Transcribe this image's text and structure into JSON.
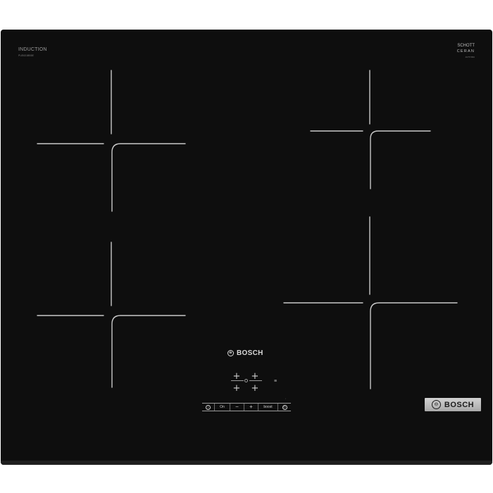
{
  "cooktop": {
    "type_label": "INDUCTION",
    "model_code": "PUE631BB5E",
    "glass_brand_top": "SCHOTT",
    "glass_brand_bottom": "CERAN",
    "serial_code": "40757682",
    "surface_color": "#0e0e0e",
    "marking_color": "#c8c8c8"
  },
  "center_logo": {
    "brand": "BOSCH",
    "icon": "bosch-armature-icon"
  },
  "zone_selector": {
    "icon": "plus-icon",
    "count": 4
  },
  "control_strip": {
    "power_icon": "power-icon",
    "on_label": "On",
    "minus_label": "−",
    "plus_label": "+",
    "boost_label": "boost",
    "timer_icon": "timer-icon"
  },
  "badge": {
    "brand": "BOSCH",
    "icon": "bosch-armature-icon",
    "background": "#bdbdbd"
  }
}
